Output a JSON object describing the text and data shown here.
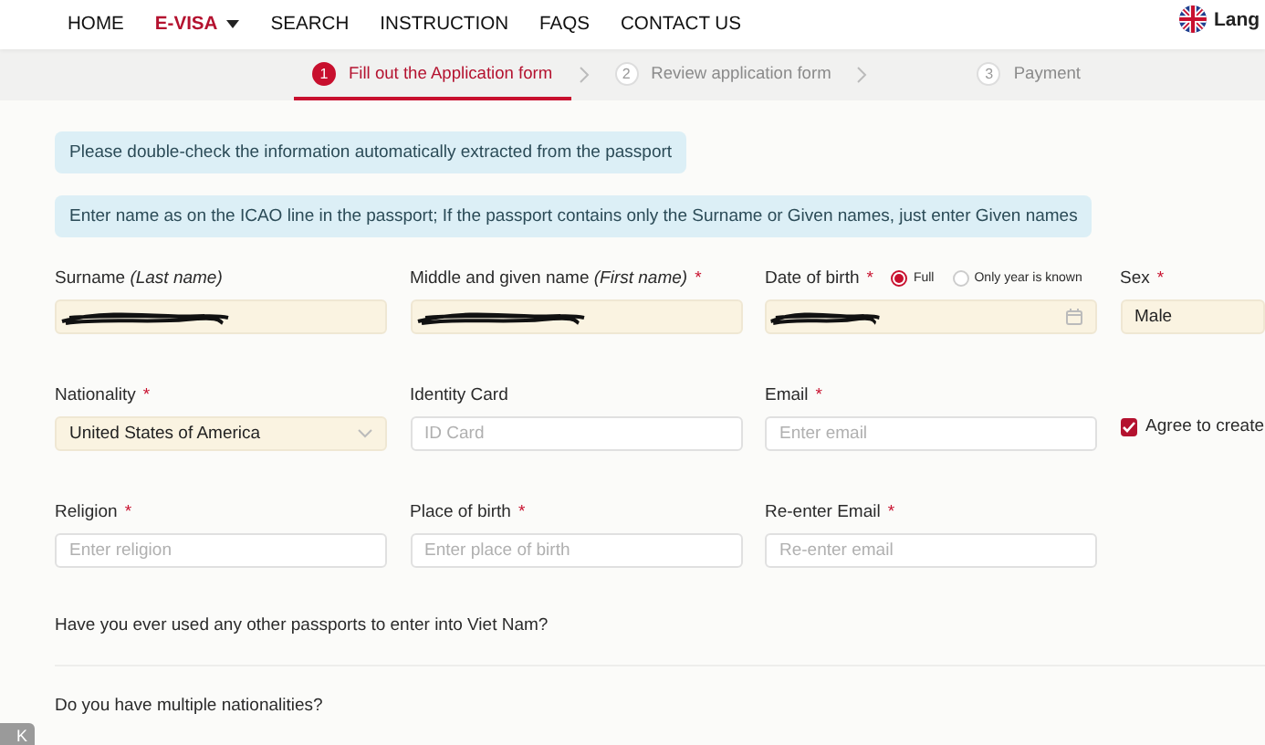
{
  "nav": {
    "items": [
      {
        "label": "HOME",
        "selected": false,
        "dropdown": false
      },
      {
        "label": "E-VISA",
        "selected": true,
        "dropdown": true
      },
      {
        "label": "SEARCH",
        "selected": false,
        "dropdown": false
      },
      {
        "label": "INSTRUCTION",
        "selected": false,
        "dropdown": false
      },
      {
        "label": "FAQS",
        "selected": false,
        "dropdown": false
      },
      {
        "label": "CONTACT US",
        "selected": false,
        "dropdown": false
      }
    ],
    "language": "Lang"
  },
  "steps": [
    {
      "number": "1",
      "label": "Fill out the Application form",
      "selected": true
    },
    {
      "number": "2",
      "label": "Review application form",
      "selected": false
    },
    {
      "number": "3",
      "label": "Payment",
      "selected": false
    }
  ],
  "notices": [
    "Please double-check the information automatically extracted from the passport",
    "Enter name as on the ICAO line in the passport; If the passport contains only the Surname or Given names, just enter Given names"
  ],
  "form_rows": [
    [
      {
        "kind": "redacted",
        "label": "Surname *(Last name)*",
        "prefilled": true
      },
      {
        "kind": "redacted",
        "label": "Middle and given name *(First name)*",
        "required_mark": "*",
        "prefilled": true
      },
      {
        "kind": "date",
        "label": "Date of birth",
        "required_mark": "*",
        "prefilled": true,
        "options": [
          {
            "label": "Full",
            "selected": true
          },
          {
            "label": "Only year is known",
            "selected": false
          }
        ]
      },
      {
        "kind": "input",
        "label": "Sex",
        "required_mark": "*",
        "prefilled": true,
        "value": "Male"
      }
    ],
    [
      {
        "kind": "select",
        "label": "Nationality",
        "required_mark": "*",
        "prefilled": true,
        "value": "United States of America"
      },
      {
        "kind": "input",
        "label": "Identity Card",
        "prefilled": false,
        "placeholder": "ID Card"
      },
      {
        "kind": "input",
        "label": "Email",
        "required_mark": "*",
        "prefilled": false,
        "placeholder": "Enter email"
      },
      {
        "kind": "checkbox",
        "label": "Agree to create",
        "checked": true
      }
    ],
    [
      {
        "kind": "input",
        "label": "Religion",
        "required_mark": "*",
        "prefilled": false,
        "placeholder": "Enter religion"
      },
      {
        "kind": "input",
        "label": "Place of birth",
        "required_mark": "*",
        "prefilled": false,
        "placeholder": "Enter place of birth"
      },
      {
        "kind": "input",
        "label": "Re-enter Email",
        "required_mark": "*",
        "prefilled": false,
        "placeholder": "Re-enter email"
      }
    ]
  ],
  "questions": [
    "Have you ever used any other passports to enter into Viet Nam?",
    "Do you have multiple nationalities?"
  ],
  "corner_badge": "K"
}
